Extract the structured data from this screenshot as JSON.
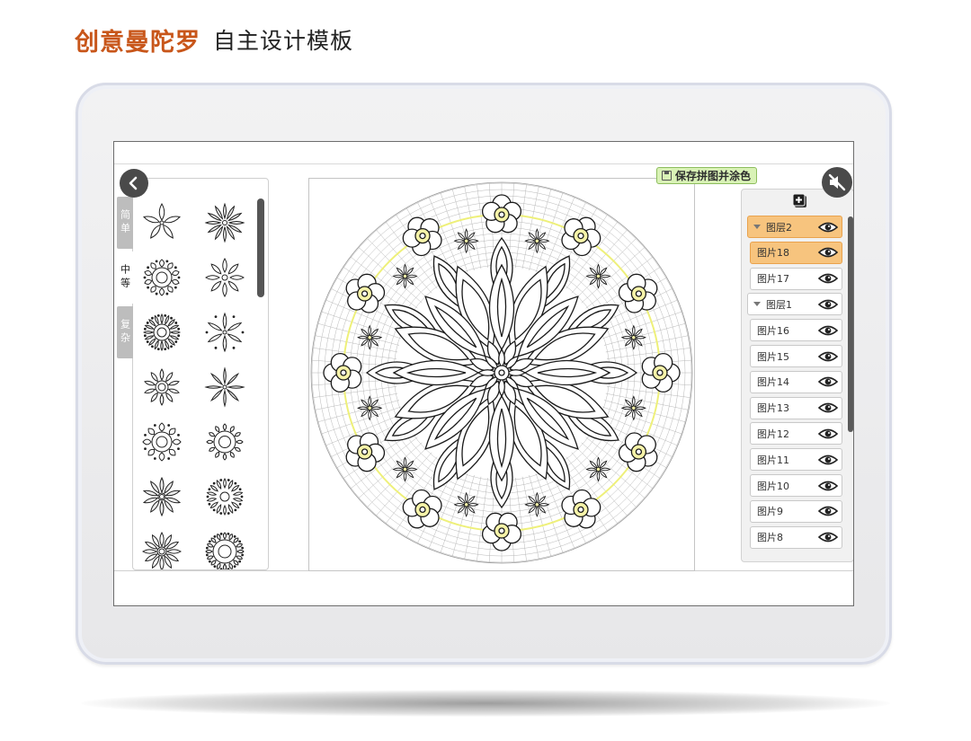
{
  "headline": {
    "accent": "创意曼陀罗",
    "rest": "自主设计模板"
  },
  "colors": {
    "headline_accent": "#c8561a",
    "device_frame": "#e8e8ea",
    "save_button_bg": "#d9f2b6",
    "selected_layer": "#f7c47e",
    "guide_circle": "#eef07a"
  },
  "toolbar": {
    "back_icon": "chevron-left-icon",
    "save_label": "保存拼图并涂色",
    "mute_icon": "speaker-muted-icon"
  },
  "shape_panel": {
    "tabs": [
      {
        "label": "简单",
        "active": false
      },
      {
        "label": "中等",
        "active": true
      },
      {
        "label": "复杂",
        "active": false
      }
    ],
    "shape_count": 14
  },
  "layer_panel": {
    "add_icon": "add-layer-icon",
    "rows": [
      {
        "label": "图层2",
        "type": "group",
        "selected": true
      },
      {
        "label": "图片18",
        "type": "item",
        "selected": true
      },
      {
        "label": "图片17",
        "type": "item",
        "selected": false
      },
      {
        "label": "图层1",
        "type": "group",
        "selected": false
      },
      {
        "label": "图片16",
        "type": "item",
        "selected": false
      },
      {
        "label": "图片15",
        "type": "item",
        "selected": false
      },
      {
        "label": "图片14",
        "type": "item",
        "selected": false
      },
      {
        "label": "图片13",
        "type": "item",
        "selected": false
      },
      {
        "label": "图片12",
        "type": "item",
        "selected": false
      },
      {
        "label": "图片11",
        "type": "item",
        "selected": false
      },
      {
        "label": "图片10",
        "type": "item",
        "selected": false
      },
      {
        "label": "图片9",
        "type": "item",
        "selected": false
      },
      {
        "label": "图片8",
        "type": "item",
        "selected": false
      }
    ]
  }
}
